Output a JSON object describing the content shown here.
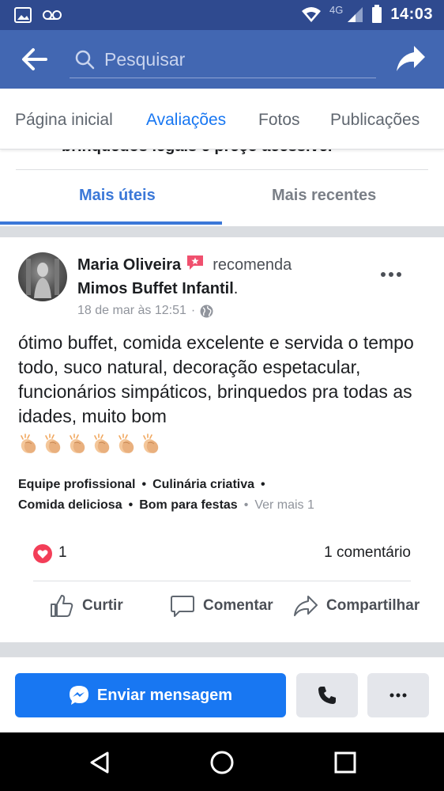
{
  "status_bar": {
    "network": "4G",
    "time": "14:03"
  },
  "search": {
    "placeholder": "Pesquisar"
  },
  "tabs": [
    {
      "label": "Página inicial",
      "active": false
    },
    {
      "label": "Avaliações",
      "active": true
    },
    {
      "label": "Fotos",
      "active": false
    },
    {
      "label": "Publicações",
      "active": false
    }
  ],
  "previous_review_cut_text": "brinquedos legais e preço acessível",
  "sort": {
    "helpful_label": "Mais úteis",
    "recent_label": "Mais recentes"
  },
  "review": {
    "author": "Maria Oliveira",
    "recommend_text": "recomenda",
    "page_name": "Mimos Buffet Infantil",
    "page_name_suffix": ".",
    "timestamp": "18 de mar às 12:51",
    "meta_separator": "·",
    "body": "ótimo buffet, comida excelente e servida o tempo todo, suco natural, decoração espetacular, funcionários simpáticos, brinquedos pra todas as idades, muito bom",
    "clap_count": 6,
    "tags": [
      "Equipe profissional",
      "Culinária criativa",
      "Comida deliciosa",
      "Bom para festas"
    ],
    "see_more": "Ver mais 1",
    "like_count": "1",
    "comment_count": "1 comentário"
  },
  "actions": {
    "like": "Curtir",
    "comment": "Comentar",
    "share": "Compartilhar"
  },
  "bottom": {
    "message_button": "Enviar mensagem"
  },
  "colors": {
    "header": "#4267b2",
    "status_bar": "#2f4a8f",
    "accent": "#1877f2",
    "sort_active": "#3b78d8",
    "heart": "#f33e58",
    "recommend_badge": "#f0506e"
  }
}
